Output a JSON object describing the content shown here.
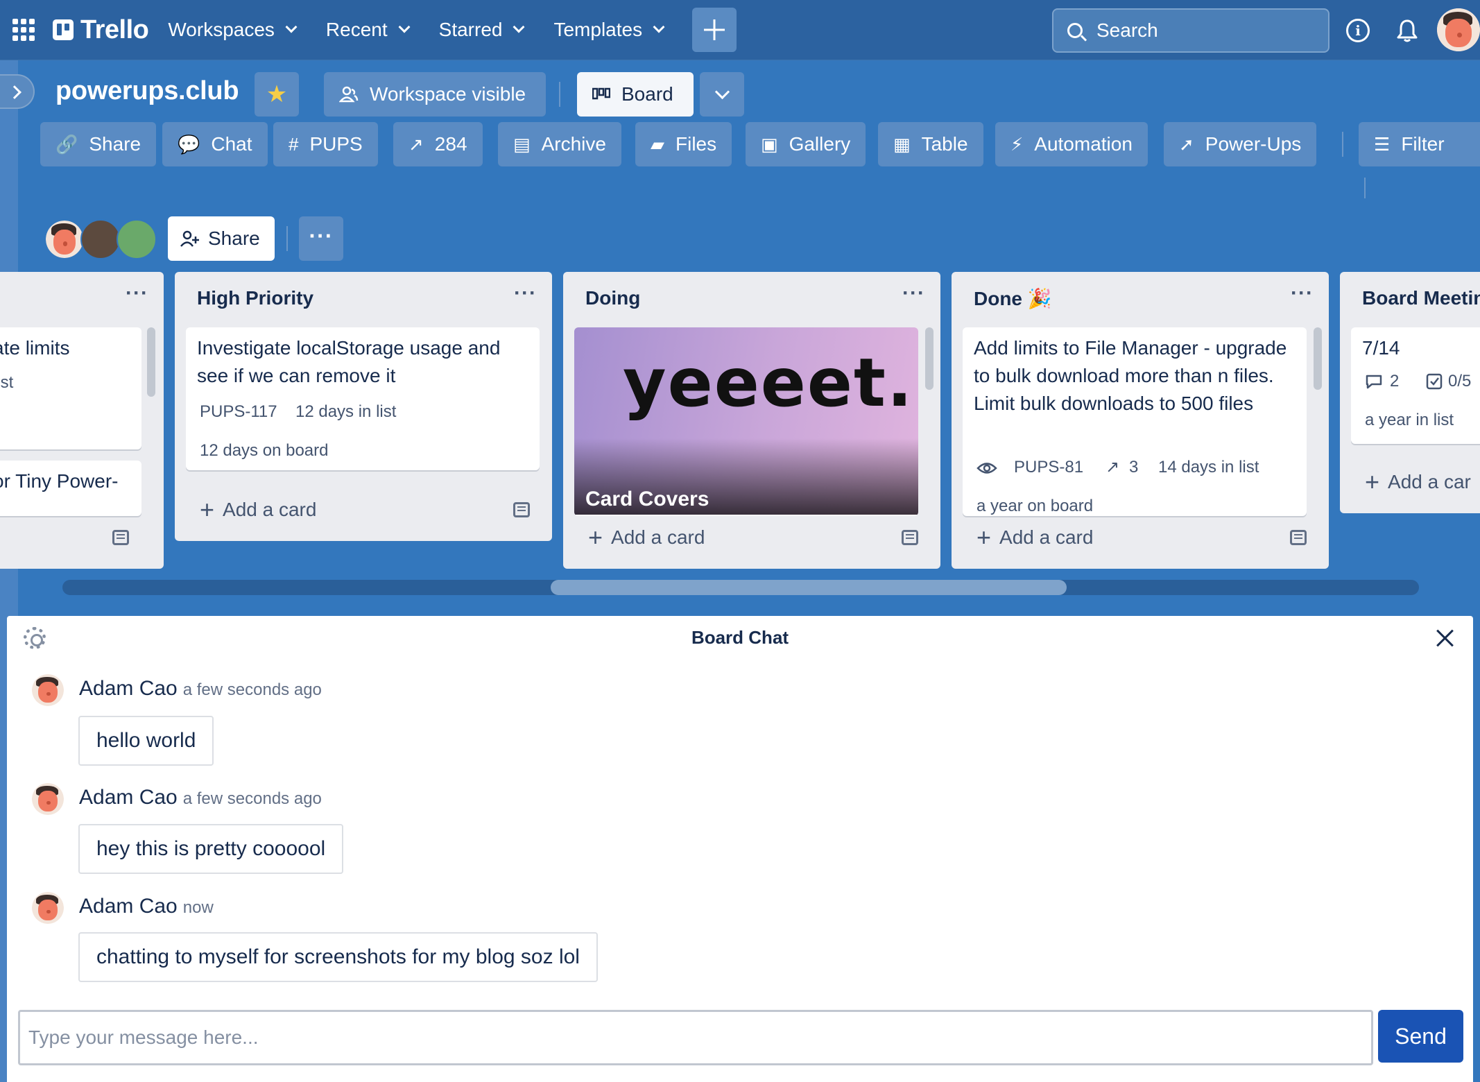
{
  "nav": {
    "logo": "Trello",
    "menus": [
      "Workspaces",
      "Recent",
      "Starred",
      "Templates"
    ],
    "search_placeholder": "Search"
  },
  "board": {
    "title": "powerups.club",
    "visibility_label": "Workspace visible",
    "view_label": "Board"
  },
  "toolbar": {
    "items": [
      {
        "label": "Share",
        "icon": "link-icon"
      },
      {
        "label": "Chat",
        "icon": "chat-icon"
      },
      {
        "label": "PUPS",
        "icon": "hash-icon"
      },
      {
        "label": "284",
        "icon": "trending-icon"
      },
      {
        "label": "Archive",
        "icon": "archive-icon"
      },
      {
        "label": "Files",
        "icon": "folder-icon"
      },
      {
        "label": "Gallery",
        "icon": "gallery-icon"
      },
      {
        "label": "Table",
        "icon": "table-icon"
      },
      {
        "label": "Automation",
        "icon": "bolt-icon"
      },
      {
        "label": "Power-Ups",
        "icon": "rocket-icon"
      },
      {
        "label": "Filter",
        "icon": "filter-icon"
      }
    ]
  },
  "members": {
    "share_label": "Share",
    "more_label": "···"
  },
  "lists": [
    {
      "title": "",
      "cards": [
        {
          "text": "ate limits",
          "meta": "list"
        },
        {
          "text": "or Tiny Power-"
        }
      ]
    },
    {
      "title": "High Priority",
      "cards": [
        {
          "text": "Investigate localStorage usage and see if we can remove it",
          "id": "PUPS-117",
          "in_list": "12 days in list",
          "on_board": "12 days on board"
        }
      ],
      "add_label": "Add a card"
    },
    {
      "title": "Doing",
      "cards": [
        {
          "cover_text": "yeeeet.",
          "title": "Card Covers"
        }
      ],
      "add_label": "Add a card"
    },
    {
      "title": "Done 🎉",
      "cards": [
        {
          "text": "Add limits to File Manager - upgrade to bulk download more than n files. Limit bulk downloads to 500 files",
          "id": "PUPS-81",
          "trend": "3",
          "in_list": "14 days in list",
          "on_board": "a year on board"
        }
      ],
      "add_label": "Add a card"
    },
    {
      "title": "Board Meetin",
      "cards": [
        {
          "text": "7/14",
          "comments": "2",
          "checklist": "0/5",
          "in_list": "a year in list"
        }
      ],
      "add_label": "Add a car"
    }
  ],
  "chat": {
    "title": "Board Chat",
    "messages": [
      {
        "author": "Adam Cao",
        "time": "a few seconds ago",
        "text": "hello world"
      },
      {
        "author": "Adam Cao",
        "time": "a few seconds ago",
        "text": "hey this is pretty coooool"
      },
      {
        "author": "Adam Cao",
        "time": "now",
        "text": "chatting to myself for screenshots for my blog soz lol"
      }
    ],
    "input_placeholder": "Type your message here...",
    "send_label": "Send"
  },
  "colors": {
    "nav": "#2c62a0",
    "board_bg": "#3377bd",
    "button": "#5a8bc3",
    "send": "#1a53b4",
    "star": "#f5cd47"
  }
}
